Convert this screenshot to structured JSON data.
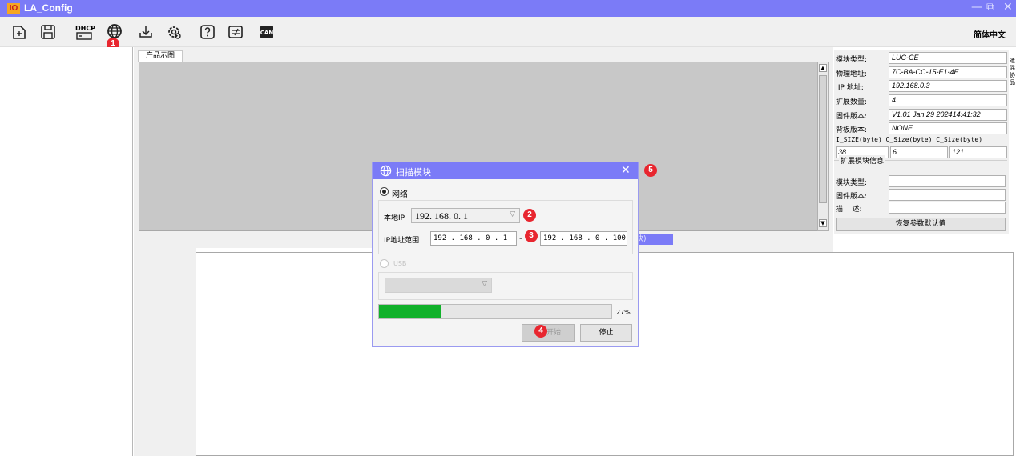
{
  "window": {
    "title": "LA_Config",
    "logo_text": "IO",
    "language": "简体中文",
    "controls": [
      "—",
      "⧉",
      "✕"
    ]
  },
  "toolbar": {
    "icons": [
      "open-file-icon",
      "save-icon",
      "dhcp-icon",
      "scan-module-icon",
      "download-icon",
      "settings-icon",
      "help-icon",
      "adjust-icon",
      "can-icon"
    ],
    "dhcp_text": "DHCP"
  },
  "tab": {
    "label": "产品示图"
  },
  "props": {
    "rows": [
      {
        "label": "模块类型:",
        "value": "LUC-CE"
      },
      {
        "label": "物理地址:",
        "value": "7C-BA-CC-15-E1-4E"
      },
      {
        "label": " IP 地址:",
        "value": "192.168.0.3"
      },
      {
        "label": "扩展数量:",
        "value": "4"
      },
      {
        "label": "固件版本:",
        "value": "V1.01 Jan 29 202414:41:32"
      },
      {
        "label": "背板版本:",
        "value": "NONE"
      }
    ],
    "size_header": "I_SIZE(byte) O_Size(byte) C_Size(byte)",
    "i_size": "38",
    "o_size": "6",
    "c_size": "121",
    "ext_title": "扩展模块信息",
    "ext_rows": [
      "模块类型:",
      "固件版本:",
      "描    述:"
    ],
    "restore_label": "恢复参数默认值",
    "edge_text": "遣 滛 协 品"
  },
  "strip_text": "块)",
  "dialog": {
    "title": "扫描模块",
    "close": "✕",
    "network_label": "网络",
    "local_ip_label": "本地IP",
    "local_ip_value": "192. 168. 0. 1",
    "ip_range_label": "IP地址范围",
    "ip_start": "192 . 168 .  0  . 1",
    "ip_sep": "-",
    "ip_end": "192 . 168 .  0  . 100",
    "usb_label": "USB",
    "progress_percent": 27,
    "progress_text": "27%",
    "start_label": "开始",
    "stop_label": "停止"
  },
  "badges": [
    "1",
    "2",
    "3",
    "4",
    "5"
  ],
  "colors": {
    "accent": "#7b7bf7",
    "progress": "#11b12a",
    "badge": "#e8262f"
  }
}
